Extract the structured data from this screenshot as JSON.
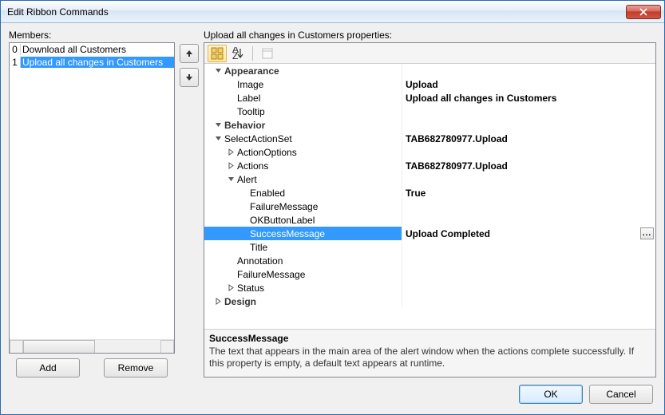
{
  "dialog": {
    "title": "Edit Ribbon Commands",
    "members_label": "Members:",
    "properties_label": "Upload all changes in Customers properties:",
    "add_label": "Add",
    "remove_label": "Remove",
    "ok_label": "OK",
    "cancel_label": "Cancel"
  },
  "members": [
    {
      "index": "0",
      "text": "Download all Customers",
      "selected": false
    },
    {
      "index": "1",
      "text": "Upload all changes in Customers",
      "selected": true
    }
  ],
  "toolbar": {
    "categorized_tip": "Categorized",
    "alphabetical_tip": "Alphabetical",
    "pages_tip": "Property Pages"
  },
  "property_rows": [
    {
      "type": "cat",
      "indent": 0,
      "expander": "open",
      "name": "Appearance",
      "value": ""
    },
    {
      "type": "prop",
      "indent": 1,
      "expander": "none",
      "name": "Image",
      "value": "Upload"
    },
    {
      "type": "prop",
      "indent": 1,
      "expander": "none",
      "name": "Label",
      "value": "Upload all changes in Customers"
    },
    {
      "type": "prop",
      "indent": 1,
      "expander": "none",
      "name": "Tooltip",
      "value": ""
    },
    {
      "type": "cat",
      "indent": 0,
      "expander": "open",
      "name": "Behavior",
      "value": ""
    },
    {
      "type": "prop",
      "indent": 0,
      "expander": "open",
      "name": "SelectActionSet",
      "value": "TAB682780977.Upload"
    },
    {
      "type": "prop",
      "indent": 1,
      "expander": "closed",
      "name": "ActionOptions",
      "value": ""
    },
    {
      "type": "prop",
      "indent": 1,
      "expander": "closed",
      "name": "Actions",
      "value": "TAB682780977.Upload"
    },
    {
      "type": "prop",
      "indent": 1,
      "expander": "open",
      "name": "Alert",
      "value": ""
    },
    {
      "type": "prop",
      "indent": 2,
      "expander": "none",
      "name": "Enabled",
      "value": "True"
    },
    {
      "type": "prop",
      "indent": 2,
      "expander": "none",
      "name": "FailureMessage",
      "value": ""
    },
    {
      "type": "prop",
      "indent": 2,
      "expander": "none",
      "name": "OKButtonLabel",
      "value": ""
    },
    {
      "type": "prop",
      "indent": 2,
      "expander": "none",
      "name": "SuccessMessage",
      "value": "Upload  Completed",
      "selected": true,
      "editor": "ellipsis"
    },
    {
      "type": "prop",
      "indent": 2,
      "expander": "none",
      "name": "Title",
      "value": ""
    },
    {
      "type": "prop",
      "indent": 1,
      "expander": "none",
      "name": "Annotation",
      "value": ""
    },
    {
      "type": "prop",
      "indent": 1,
      "expander": "none",
      "name": "FailureMessage",
      "value": ""
    },
    {
      "type": "prop",
      "indent": 1,
      "expander": "closed",
      "name": "Status",
      "value": ""
    },
    {
      "type": "cat",
      "indent": 0,
      "expander": "closed",
      "name": "Design",
      "value": ""
    }
  ],
  "help": {
    "title": "SuccessMessage",
    "body": "The text that appears in the main area of the alert window when the actions complete successfully. If this property is empty, a default text appears at runtime."
  },
  "icons": {
    "ellipsis_label": "..."
  },
  "colors": {
    "selection": "#3399ff",
    "accent_ok": "#3c7fb1"
  }
}
